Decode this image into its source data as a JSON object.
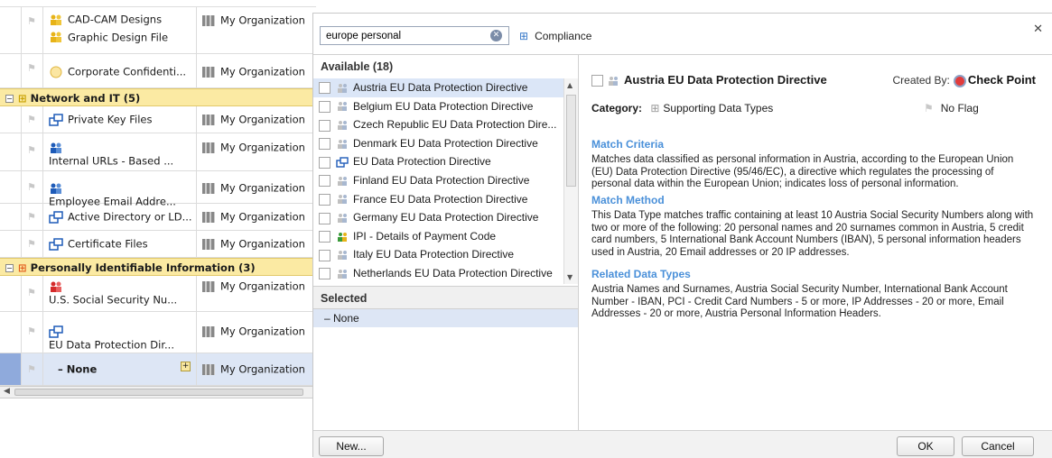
{
  "left_grid": {
    "rows": [
      {
        "name_line1": "CAD-CAM Designs",
        "name_line2": "Graphic Design File",
        "owner": "My Organization"
      },
      {
        "name": "Corporate Confidenti...",
        "owner": "My Organization"
      },
      {
        "name": "Private Key Files",
        "owner": "My Organization"
      },
      {
        "name": "Internal URLs - Based ...",
        "owner": "My Organization"
      },
      {
        "name": "Employee Email Addre...",
        "owner": "My Organization"
      },
      {
        "name": "Active Directory or LD...",
        "owner": "My Organization"
      },
      {
        "name": "Certificate Files",
        "owner": "My Organization"
      },
      {
        "name": "U.S. Social Security Nu...",
        "owner": "My Organization"
      },
      {
        "name": "EU Data Protection Dir...",
        "owner": "My Organization"
      },
      {
        "name": "– None",
        "owner": "My Organization"
      }
    ],
    "groups": [
      {
        "label": "Network and IT  (5)"
      },
      {
        "label": "Personally Identifiable Information  (3)"
      }
    ]
  },
  "dialog": {
    "search": {
      "value": "europe personal"
    },
    "filter_label": "Compliance",
    "available_title": "Available (18)",
    "available_items": [
      "Austria EU Data Protection Directive",
      "Belgium EU Data Protection Directive",
      "Czech Republic EU Data Protection Dire...",
      "Denmark EU Data Protection Directive",
      "EU Data Protection Directive",
      "Finland EU Data Protection Directive",
      "France EU Data Protection Directive",
      "Germany EU Data Protection Directive",
      "IPI - Details of Payment Code",
      "Italy EU Data Protection Directive",
      "Netherlands EU Data Protection Directive"
    ],
    "selected_title": "Selected",
    "selected_none": "–  None",
    "detail": {
      "name": "Austria EU Data Protection Directive",
      "created_by_label": "Created By:",
      "created_by_value": "Check Point",
      "category_label": "Category:",
      "category_value": "Supporting Data Types",
      "flag_value": "No Flag",
      "match_criteria_h": "Match Criteria",
      "match_criteria": "Matches data classified as personal information in Austria, according to the European Union (EU) Data Protection Directive (95/46/EC), a directive which regulates the processing of personal data within the European Union; indicates loss of personal information.",
      "match_method_h": "Match Method",
      "match_method": "This Data Type matches traffic containing at least 10 Austria Social Security Numbers along with two or more of the following: 20 personal names and 20 surnames common in Austria, 5 credit card numbers, 5 International Bank Account Numbers (IBAN), 5 personal information headers used in Austria, 20 Email addresses or 20 IP addresses.",
      "related_h": "Related Data Types",
      "related": "Austria Names and Surnames, Austria Social Security Number, International Bank Account Number - IBAN, PCI - Credit Card Numbers - 5 or more, IP Addresses - 20 or more, Email Addresses - 20 or more, Austria Personal Information Headers."
    },
    "buttons": {
      "new": "New...",
      "ok": "OK",
      "cancel": "Cancel"
    }
  }
}
